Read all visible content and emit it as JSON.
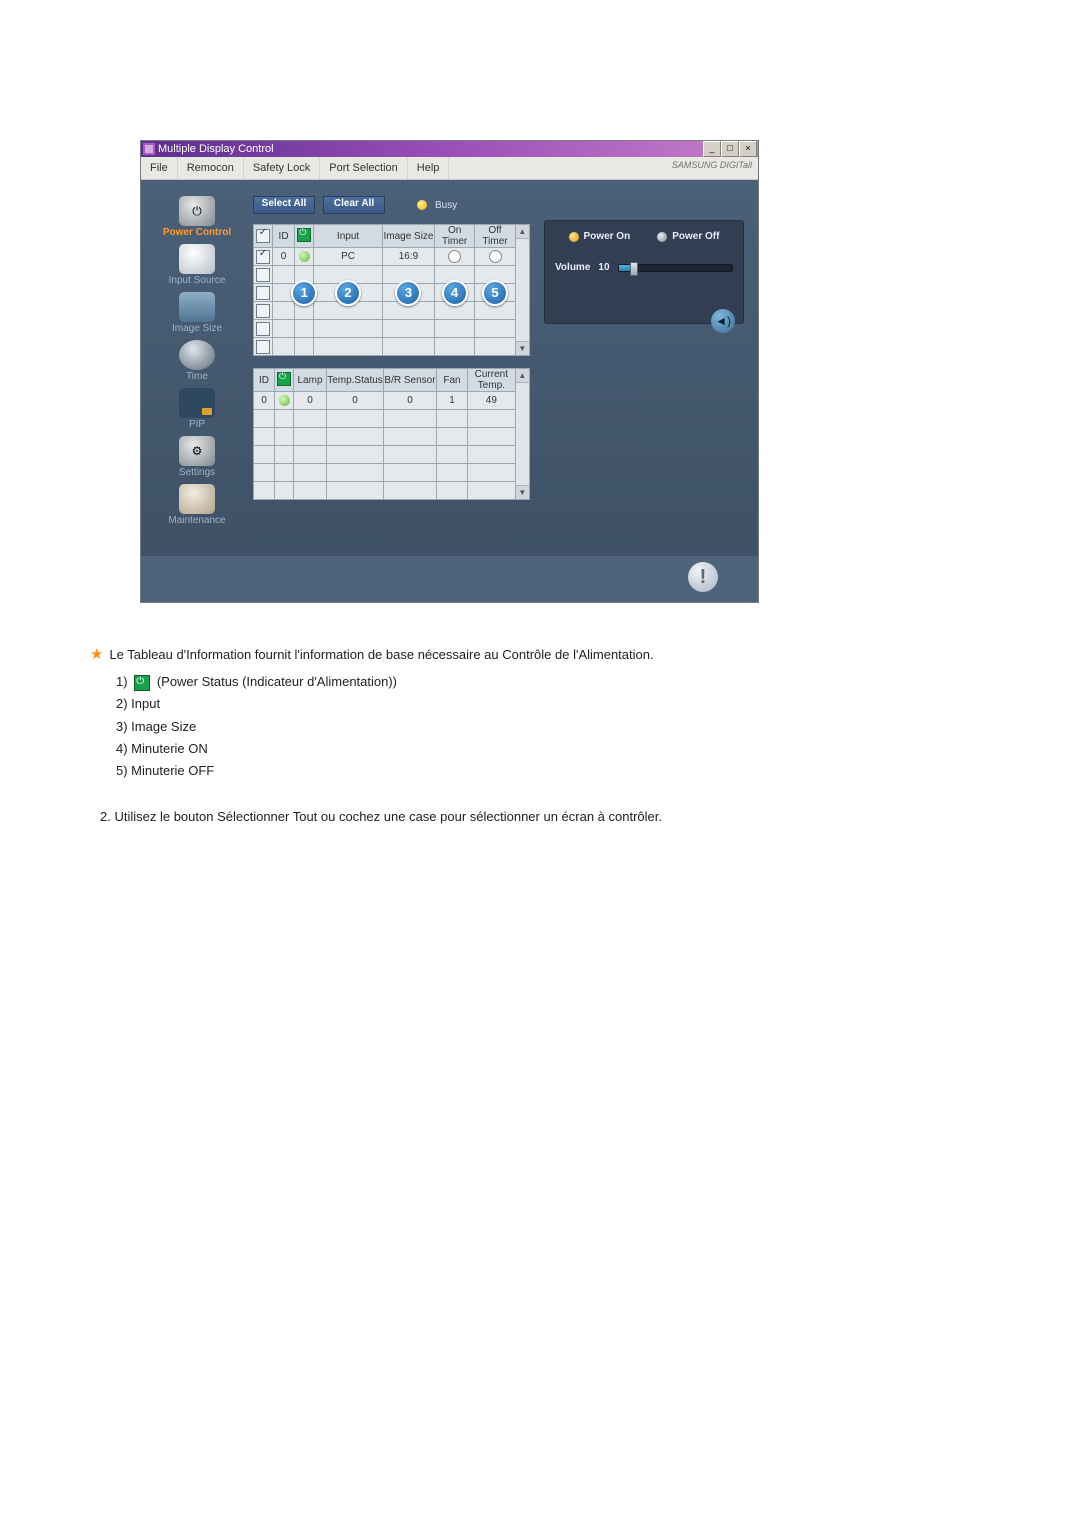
{
  "window": {
    "title": "Multiple Display Control",
    "buttons": {
      "min": "_",
      "max": "□",
      "close": "×"
    }
  },
  "menu": {
    "items": [
      "File",
      "Remocon",
      "Safety Lock",
      "Port Selection",
      "Help"
    ],
    "brand": "SAMSUNG DIGITall"
  },
  "sidebar": {
    "items": [
      {
        "label": "Power Control",
        "active": true
      },
      {
        "label": "Input Source"
      },
      {
        "label": "Image Size"
      },
      {
        "label": "Time"
      },
      {
        "label": "PIP"
      },
      {
        "label": "Settings"
      },
      {
        "label": "Maintenance"
      }
    ]
  },
  "toolbar": {
    "select_all": "Select All",
    "clear_all": "Clear All",
    "busy": "Busy"
  },
  "grid1": {
    "headers": {
      "id": "ID",
      "input": "Input",
      "image_size": "Image Size",
      "on_timer": "On Timer",
      "off_timer": "Off Timer"
    },
    "rows": [
      {
        "checked": true,
        "id": "0",
        "power": "green",
        "input": "PC",
        "image_size": "16:9",
        "on_timer": "hollow",
        "off_timer": "hollow"
      },
      {
        "checked": false
      },
      {
        "checked": false
      },
      {
        "checked": false
      },
      {
        "checked": false
      },
      {
        "checked": false
      }
    ]
  },
  "callouts": [
    "1",
    "2",
    "3",
    "4",
    "5"
  ],
  "grid2": {
    "headers": {
      "id": "ID",
      "lamp": "Lamp",
      "temp_status": "Temp.Status",
      "br_sensor": "B/R Sensor",
      "fan": "Fan",
      "current_temp": "Current Temp."
    },
    "rows": [
      {
        "id": "0",
        "power": "green",
        "lamp": "0",
        "temp_status": "0",
        "br_sensor": "0",
        "fan": "1",
        "current_temp": "49"
      },
      {},
      {},
      {},
      {},
      {}
    ]
  },
  "panel": {
    "power_on": "Power On",
    "power_off": "Power Off",
    "volume_label": "Volume",
    "volume_value": "10"
  },
  "article": {
    "intro": "Le Tableau d'Information fournit l'information de base nécessaire au Contrôle de l'Alimentation.",
    "items": {
      "i1_prefix": "1)",
      "i1_text": "(Power Status (Indicateur d'Alimentation))",
      "i2": "2) Input",
      "i3": "3) Image Size",
      "i4": "4) Minuterie ON",
      "i5": "5) Minuterie OFF"
    },
    "note2": "2.  Utilisez le bouton Sélectionner Tout ou cochez une case pour sélectionner un écran à contrôler."
  }
}
